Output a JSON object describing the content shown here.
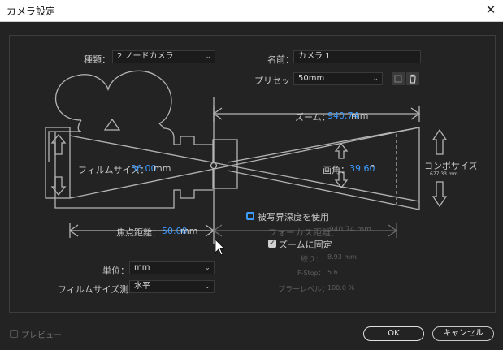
{
  "window": {
    "title": "カメラ設定",
    "close_glyph": "✕"
  },
  "type_row": {
    "label": "種類：",
    "value": "2 ノードカメラ"
  },
  "name_row": {
    "label": "名前：",
    "value": "カメラ 1"
  },
  "preset_row": {
    "label": "プリセット：",
    "value": "50mm"
  },
  "zoom": {
    "label": "ズーム：",
    "value": "940.74",
    "unit": "mm"
  },
  "film_size": {
    "label": "フィルムサイズ：",
    "value": "36.00",
    "unit": "mm"
  },
  "angle": {
    "label": "画角：",
    "value": "39.60",
    "unit": "°"
  },
  "comp_size": {
    "label": "コンポサイズ",
    "value": "677.33 mm"
  },
  "depth_of_field": {
    "label": "被写界深度を使用",
    "checked": false
  },
  "focal_length": {
    "label": "焦点距離：",
    "value": "50.00",
    "unit": "mm"
  },
  "focus_distance": {
    "label": "フォーカス距離：",
    "value": "940.74 mm"
  },
  "lock_to_zoom": {
    "label": "ズームに固定",
    "checked": true
  },
  "aperture": {
    "label": "絞り：",
    "value": "8.93 mm"
  },
  "fstop": {
    "label": "F-Stop：",
    "value": "5.6"
  },
  "blur_level": {
    "label": "ブラーレベル：",
    "value": "100.0 %"
  },
  "units": {
    "label": "単位：",
    "value": "mm"
  },
  "film_measure": {
    "label": "フィルムサイズ測定：",
    "value": "水平"
  },
  "preview": {
    "label": "プレビュー",
    "checked": false
  },
  "buttons": {
    "ok": "OK",
    "cancel": "キャンセル"
  },
  "colors": {
    "accent": "#3d9bff",
    "background": "#232323",
    "line": "#b4b4b4"
  },
  "icons": [
    "close-icon",
    "chevron-down-icon",
    "save-preset-icon",
    "trash-icon",
    "checkmark-icon",
    "arrow-up-icon",
    "arrow-down-icon",
    "camera-outline-icon",
    "mouse-cursor-icon"
  ]
}
